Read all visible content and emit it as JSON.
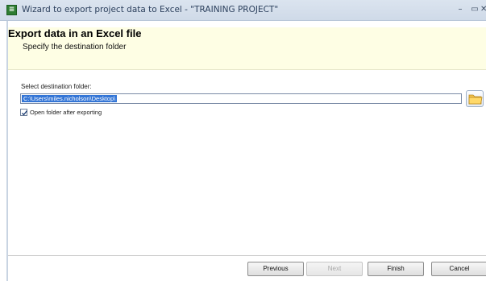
{
  "window": {
    "title": "Wizard to export project data to Excel - \"TRAINING PROJECT\"",
    "controls": {
      "minimize": "–",
      "maximize": "▭",
      "close": "✕"
    }
  },
  "header": {
    "title": "Export data in an Excel file",
    "subtitle": "Specify the destination folder",
    "background": "#fefee4"
  },
  "form": {
    "folder_label": "Select destination folder:",
    "folder_path": "C:\\Users\\miles.nicholson\\Desktop\\",
    "browse_icon": "folder-icon",
    "open_after_export": {
      "label": "Open folder after exporting",
      "checked": true
    }
  },
  "footer": {
    "previous_label": "Previous",
    "next_label": "Next",
    "next_enabled": false,
    "finish_label": "Finish",
    "cancel_label": "Cancel"
  },
  "colors": {
    "selection": "#3375d6",
    "titlebar": "#dbe4ef"
  }
}
